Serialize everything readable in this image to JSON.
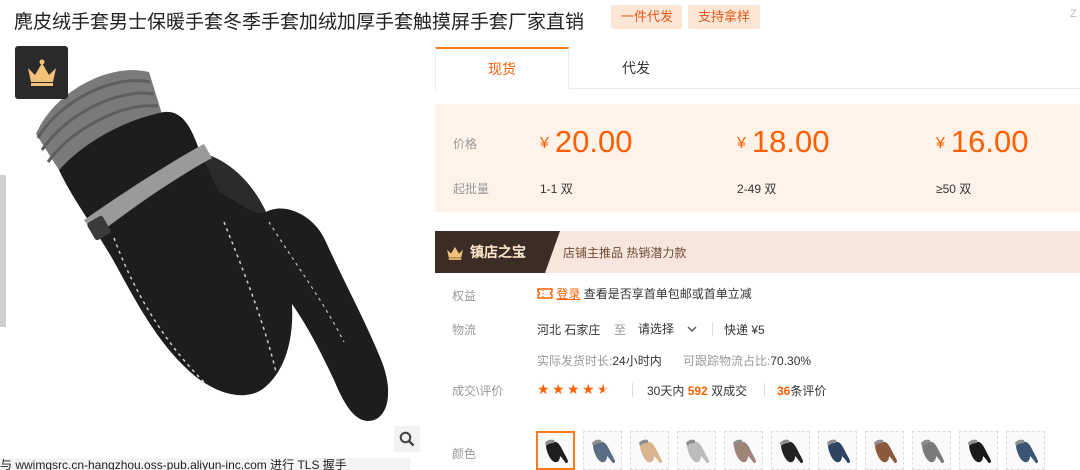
{
  "title": "麂皮绒手套男士保暖手套冬季手套加绒加厚手套触摸屏手套厂家直销",
  "tags": [
    "一件代发",
    "支持拿样"
  ],
  "corner_mark": "Z",
  "status_bar": "与 wwimgsrc.cn-hangzhou.oss-pub.aliyun-inc.com 进行 TLS 握手",
  "tabs": [
    {
      "label": "现货",
      "active": true
    },
    {
      "label": "代发",
      "active": false
    }
  ],
  "price": {
    "price_label": "价格",
    "moq_label": "起批量",
    "currency": "¥",
    "tiers": [
      {
        "price": "20.00",
        "range": "1-1",
        "unit": "双"
      },
      {
        "price": "18.00",
        "range": "2-49",
        "unit": "双"
      },
      {
        "price": "16.00",
        "range": "≥50",
        "unit": "双"
      }
    ]
  },
  "banner": {
    "badge": "镇店之宝",
    "text": "店铺主推品  热销潜力款"
  },
  "rights": {
    "label": "权益",
    "login_link": "登录",
    "text": "查看是否享首单包邮或首单立减"
  },
  "logistics": {
    "label": "物流",
    "origin": "河北 石家庄",
    "to": "至",
    "select": "请选择",
    "express": "快递 ¥5",
    "ship_time_label": "实际发货时长:",
    "ship_time_value": "24小时内",
    "trace_label": "可跟踪物流占比:",
    "trace_value": "70.30%"
  },
  "reviews": {
    "label": "成交\\评价",
    "rating": 4.5,
    "sold_prefix": "30天内",
    "sold_count": "592",
    "sold_suffix": "双成交",
    "review_count": "36",
    "review_suffix": "条评价"
  },
  "color": {
    "label": "颜色",
    "swatches": [
      "#1e1e1e",
      "#5a6c86",
      "#d9b48f",
      "#bcbcbc",
      "#9c8478",
      "#222222",
      "#2f4460",
      "#8a5a3a",
      "#7a7a7a",
      "#1a1a1a",
      "#3d5575"
    ]
  },
  "colors": {
    "accent": "#ff5f00",
    "tag_bg": "#fbe6d5",
    "price_bg": "#fff2e9",
    "banner_bg": "#f7e6dc",
    "banner_dark": "#3b2c26"
  },
  "icons": [
    "crown-icon",
    "search-icon",
    "coupon-icon",
    "chevron-down-icon",
    "glove-icon"
  ]
}
